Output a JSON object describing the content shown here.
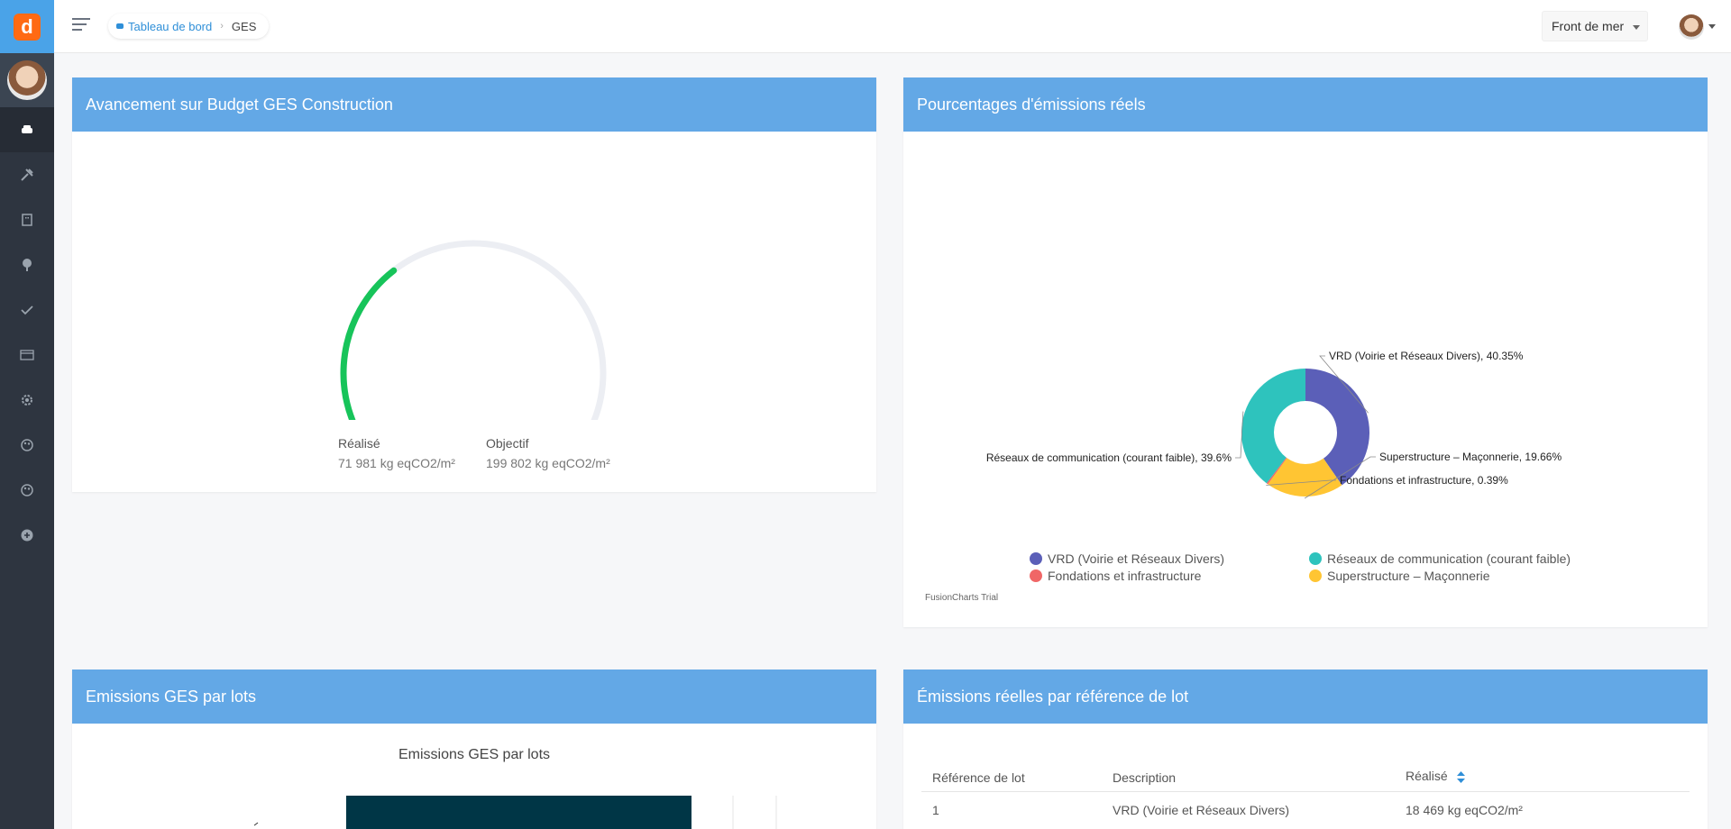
{
  "app": {
    "logo_letter": "d"
  },
  "breadcrumb": {
    "home_label": "Tableau de bord",
    "current_label": "GES"
  },
  "topbar": {
    "site_selected": "Front de mer"
  },
  "sidebar": {
    "items": [
      {
        "icon": "car-icon",
        "active": true
      },
      {
        "icon": "tools-icon",
        "active": false
      },
      {
        "icon": "building-icon",
        "active": false
      },
      {
        "icon": "tree-icon",
        "active": false
      },
      {
        "icon": "check-icon",
        "active": false
      },
      {
        "icon": "browser-icon",
        "active": false
      },
      {
        "icon": "settings-icon",
        "active": false
      },
      {
        "icon": "palette-icon",
        "active": false
      },
      {
        "icon": "palette-icon",
        "active": false
      },
      {
        "icon": "add-circle-icon",
        "active": false
      }
    ]
  },
  "gauge_panel": {
    "title": "Avancement sur Budget GES Construction",
    "realise_label": "Réalisé",
    "realise_value": "71 981 kg eqCO2/m²",
    "objectif_label": "Objectif",
    "objectif_value": "199 802 kg eqCO2/m²",
    "progress_fraction": 0.36,
    "track_color": "#eceef3",
    "progress_color": "#17c45a"
  },
  "donut_panel": {
    "title": "Pourcentages d'émissions réels",
    "trial_text": "FusionCharts Trial"
  },
  "bars_panel": {
    "title": "Emissions GES par lots"
  },
  "table_panel": {
    "title": "Émissions réelles par référence de lot",
    "headers": [
      "Référence de lot",
      "Description",
      "Réalisé"
    ],
    "rows": [
      [
        "1",
        "VRD (Voirie et Réseaux Divers)",
        "18 469 kg eqCO2/m²"
      ]
    ]
  },
  "chart_data": [
    {
      "type": "pie",
      "subtype": "doughnut",
      "slices": [
        {
          "label": "VRD (Voirie et Réseaux Divers)",
          "value": 40.35,
          "color": "#5b5fb8"
        },
        {
          "label": "Réseaux de communication (courant faible)",
          "value": 39.6,
          "color": "#2ec3bd"
        },
        {
          "label": "Fondations et infrastructure",
          "value": 0.39,
          "color": "#f06666"
        },
        {
          "label": "Superstructure – Maçonnerie",
          "value": 19.66,
          "color": "#ffc533"
        }
      ],
      "data_labels": [
        "VRD (Voirie et Réseaux Divers), 40.35%",
        "Réseaux de communication (courant faible), 39.6%",
        "Fondations et infrastructure, 0.39%",
        "Superstructure – Maçonnerie, 19.66%"
      ],
      "legend": [
        "VRD (Voirie et Réseaux Divers)",
        "Réseaux de communication (courant faible)",
        "Fondations et infrastructure",
        "Superstructure – Maçonnerie"
      ],
      "legend_placement": "bottom"
    },
    {
      "type": "bar",
      "title": "Emissions GES par lots",
      "bar_color": "#003646"
    }
  ]
}
